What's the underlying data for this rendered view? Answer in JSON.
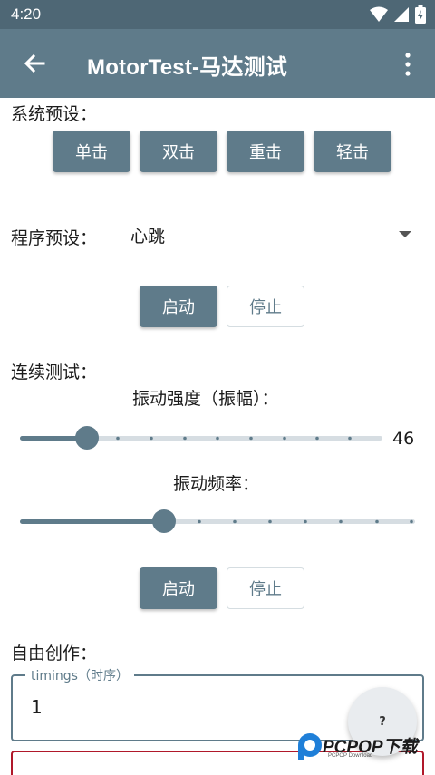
{
  "status_bar": {
    "time": "4:20"
  },
  "app_bar": {
    "title": "MotorTest-马达测试"
  },
  "system_presets": {
    "label": "系统预设：",
    "buttons": [
      "单击",
      "双击",
      "重击",
      "轻击"
    ]
  },
  "program_presets": {
    "label": "程序预设：",
    "selected": "心跳",
    "start_label": "启动",
    "stop_label": "停止"
  },
  "continuous_test": {
    "label": "连续测试：",
    "intensity_label": "振动强度（振幅）：",
    "intensity_value": "46",
    "frequency_label": "振动频率：",
    "start_label": "启动",
    "stop_label": "停止"
  },
  "free_creation": {
    "label": "自由创作：",
    "timings_label": "timings（时序）",
    "timings_value": "1"
  },
  "fab": {
    "label": "?"
  },
  "watermark": {
    "brand": "PCPOP下载",
    "sub": "PCPOP Download"
  },
  "colors": {
    "primary": "#5f7b8a",
    "status_bar": "#4e6775",
    "error": "#b0182a"
  }
}
